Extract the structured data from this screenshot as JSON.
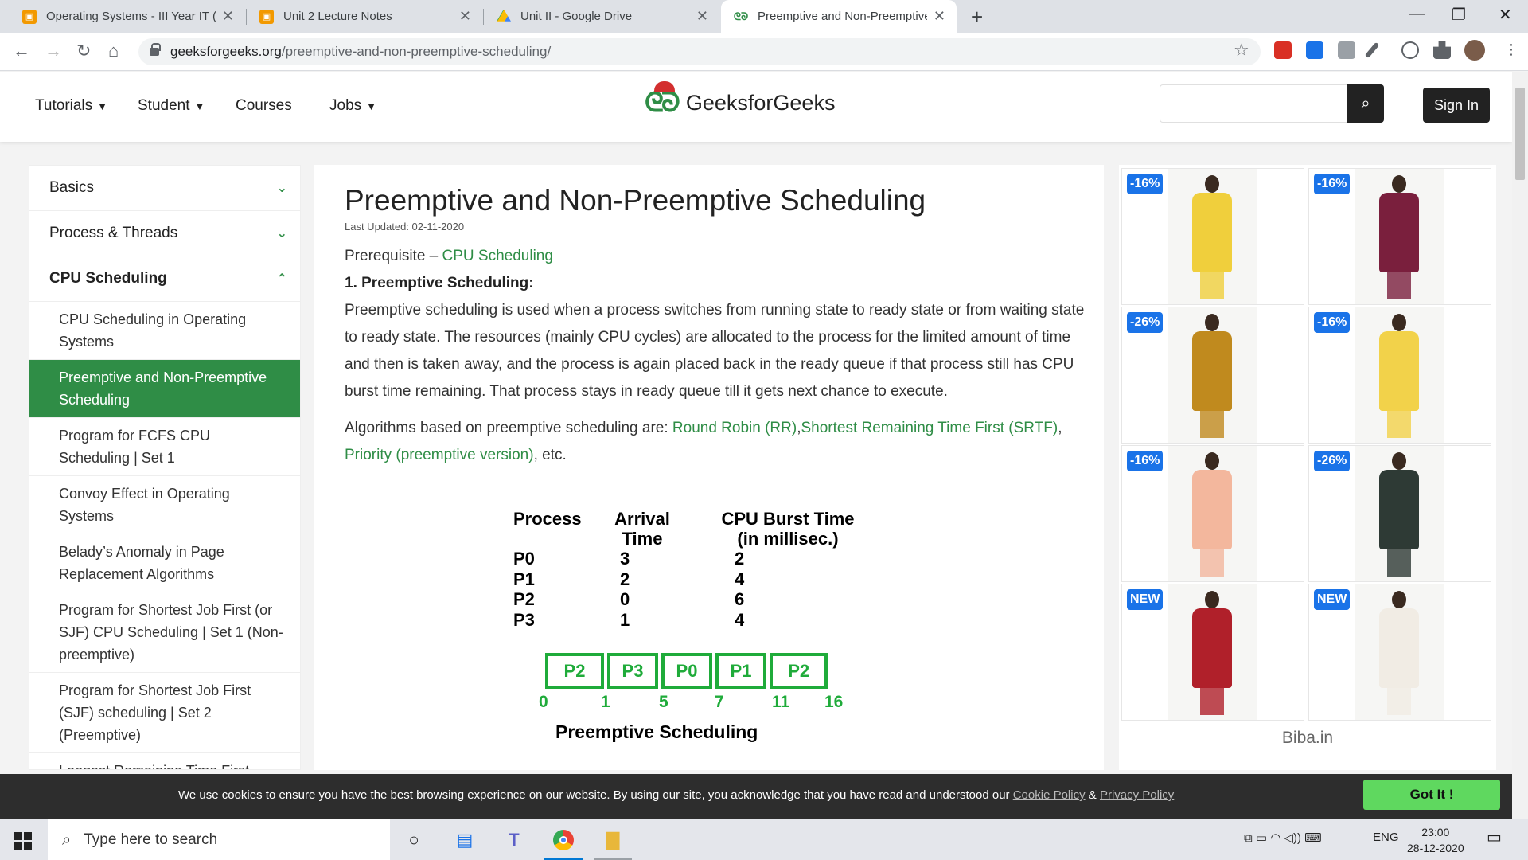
{
  "browser": {
    "tabs": [
      {
        "title": "Operating Systems - III Year IT (B…",
        "favicon": "classroom-icon",
        "color": "#f29900"
      },
      {
        "title": "Unit 2 Lecture Notes",
        "favicon": "classroom-icon",
        "color": "#f29900"
      },
      {
        "title": "Unit II - Google Drive",
        "favicon": "drive-icon",
        "color": "#1a73e8"
      },
      {
        "title": "Preemptive and Non-Preemptive",
        "favicon": "gfg-icon",
        "color": "#2f8d46"
      }
    ],
    "url_host": "geeksforgeeks.org",
    "url_path": "/preemptive-and-non-preemptive-scheduling/"
  },
  "header": {
    "nav": [
      {
        "label": "Tutorials",
        "has_menu": true
      },
      {
        "label": "Student",
        "has_menu": true
      },
      {
        "label": "Courses",
        "has_menu": false
      },
      {
        "label": "Jobs",
        "has_menu": true
      }
    ],
    "logo_text": "GeeksforGeeks",
    "signin_label": "Sign In"
  },
  "sidebar": {
    "sections": [
      {
        "label": "Basics",
        "state": "collapsed"
      },
      {
        "label": "Process & Threads",
        "state": "collapsed"
      },
      {
        "label": "CPU Scheduling",
        "state": "expanded"
      }
    ],
    "items": [
      {
        "label": "CPU Scheduling in Operating Systems",
        "active": false
      },
      {
        "label": "Preemptive and Non-Preemptive Scheduling",
        "active": true
      },
      {
        "label": "Program for FCFS CPU Scheduling | Set 1",
        "active": false
      },
      {
        "label": "Convoy Effect in Operating Systems",
        "active": false
      },
      {
        "label": "Belady’s Anomaly in Page Replacement Algorithms",
        "active": false
      },
      {
        "label": "Program for Shortest Job First (or SJF) CPU Scheduling | Set 1 (Non- preemptive)",
        "active": false
      },
      {
        "label": "Program for Shortest Job First (SJF) scheduling | Set 2 (Preemptive)",
        "active": false
      },
      {
        "label": "Longest Remaining Time First",
        "active": false
      }
    ]
  },
  "article": {
    "title": "Preemptive and Non-Preemptive Scheduling",
    "last_updated": "Last Updated: 02-11-2020",
    "prereq_text": "Prerequisite – ",
    "prereq_link": "CPU Scheduling",
    "section_heading": "1. Preemptive Scheduling:",
    "paragraph": "Preemptive scheduling is used when a process switches from running state to ready state or from waiting state to ready state. The resources (mainly CPU cycles) are allocated to the process for the limited amount of time and then is taken away, and the process is again placed back in the ready queue if that process still has CPU burst time remaining. That process stays in ready queue till it gets next chance to execute.",
    "algos_intro": "Algorithms based on preemptive scheduling are: ",
    "algo_links": [
      "Round Robin (RR)",
      "Shortest Remaining Time First (SRTF)",
      "Priority (preemptive version)"
    ],
    "algos_tail": ", etc.",
    "figure": {
      "headers": [
        "Process",
        "Arrival\nTime",
        "CPU Burst Time\n(in millisec.)"
      ],
      "rows": [
        {
          "process": "P0",
          "arrival": "3",
          "burst": "2"
        },
        {
          "process": "P1",
          "arrival": "2",
          "burst": "4"
        },
        {
          "process": "P2",
          "arrival": "0",
          "burst": "6"
        },
        {
          "process": "P3",
          "arrival": "1",
          "burst": "4"
        }
      ],
      "gantt": [
        {
          "label": "P2",
          "start": 0,
          "end": 1
        },
        {
          "label": "P3",
          "start": 1,
          "end": 5
        },
        {
          "label": "P0",
          "start": 5,
          "end": 7
        },
        {
          "label": "P1",
          "start": 7,
          "end": 11
        },
        {
          "label": "P2",
          "start": 11,
          "end": 16
        }
      ],
      "ticks": [
        "0",
        "1",
        "5",
        "7",
        "11",
        "16"
      ],
      "caption": "Preemptive Scheduling",
      "color": "#1fab3a"
    }
  },
  "ad": {
    "products": [
      {
        "badge": "-16%",
        "dress_color": "#f0cf3c"
      },
      {
        "badge": "-16%",
        "dress_color": "#7a1f3d"
      },
      {
        "badge": "-26%",
        "dress_color": "#c08a1e"
      },
      {
        "badge": "-16%",
        "dress_color": "#f2d24a"
      },
      {
        "badge": "-16%",
        "dress_color": "#f3b79d"
      },
      {
        "badge": "-26%",
        "dress_color": "#2e3a35"
      },
      {
        "badge": "NEW",
        "dress_color": "#b0202a"
      },
      {
        "badge": "NEW",
        "dress_color": "#f1ece4"
      }
    ],
    "brand": "Biba.in"
  },
  "cookie": {
    "text": "We use cookies to ensure you have the best browsing experience on our website. By using our site, you acknowledge that you have read and understood our ",
    "policy_link": "Cookie Policy",
    "amp": " & ",
    "privacy_link": "Privacy Policy",
    "button": "Got It !"
  },
  "taskbar": {
    "search_placeholder": "Type here to search",
    "lang": "ENG",
    "time": "23:00",
    "date": "28-12-2020"
  },
  "colors": {
    "brand_green": "#2f8d46"
  }
}
